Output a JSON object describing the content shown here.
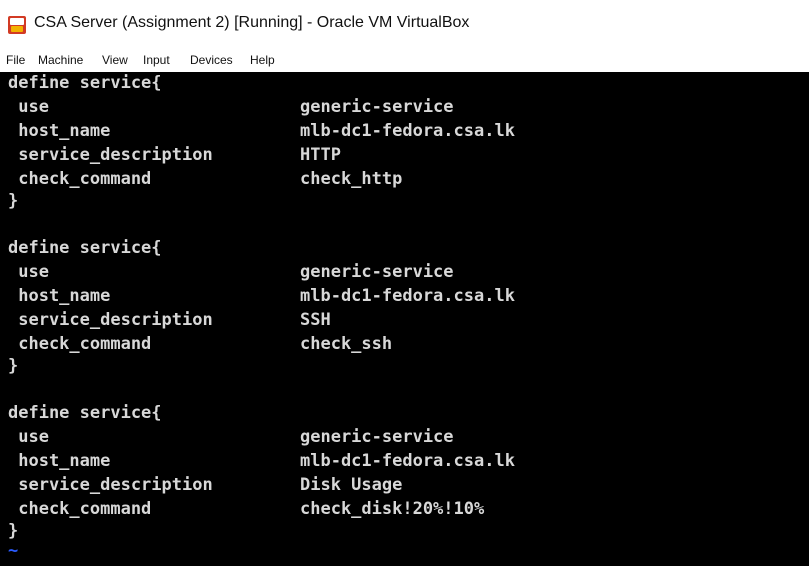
{
  "window": {
    "title": "CSA Server (Assignment 2) [Running] - Oracle VM VirtualBox",
    "icon": "virtualbox-icon"
  },
  "menubar": {
    "items": [
      "File",
      "Machine",
      "View",
      "Input",
      "Devices",
      "Help"
    ]
  },
  "console": {
    "blocks": [
      {
        "open": "define service{",
        "fields": [
          {
            "key": " use",
            "value": "generic-service"
          },
          {
            "key": " host_name",
            "value": "mlb-dc1-fedora.csa.lk"
          },
          {
            "key": " service_description",
            "value": "HTTP"
          },
          {
            "key": " check_command",
            "value": "check_http"
          }
        ],
        "close": "}"
      },
      {
        "open": "define service{",
        "fields": [
          {
            "key": " use",
            "value": "generic-service"
          },
          {
            "key": " host_name",
            "value": "mlb-dc1-fedora.csa.lk"
          },
          {
            "key": " service_description",
            "value": "SSH"
          },
          {
            "key": " check_command",
            "value": "check_ssh"
          }
        ],
        "close": "}"
      },
      {
        "open": "define service{",
        "fields": [
          {
            "key": " use",
            "value": "generic-service"
          },
          {
            "key": " host_name",
            "value": "mlb-dc1-fedora.csa.lk"
          },
          {
            "key": " service_description",
            "value": "Disk Usage"
          },
          {
            "key": " check_command",
            "value": "check_disk!20%!10%"
          }
        ],
        "close": "}"
      }
    ],
    "tilde": "~"
  },
  "colors": {
    "console_bg": "#000000",
    "console_text": "#d8d8d8",
    "tilde": "#2a5cff"
  }
}
